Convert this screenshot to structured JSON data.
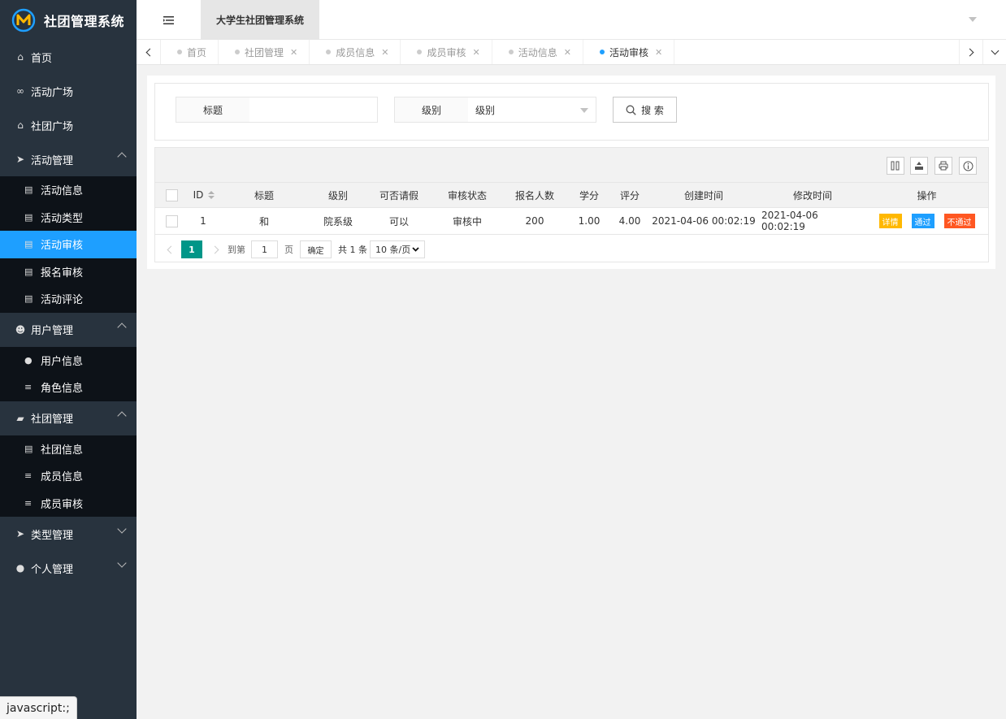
{
  "app": {
    "logo_text": "社团管理系统",
    "system_title": "大学生社团管理系统"
  },
  "sidebar": {
    "items": [
      {
        "label": "首页",
        "icon": "home-icon"
      },
      {
        "label": "活动广场",
        "icon": "bicycle-icon"
      },
      {
        "label": "社团广场",
        "icon": "bank-icon"
      },
      {
        "label": "活动管理",
        "icon": "send-icon",
        "expanded": true,
        "children": [
          {
            "label": "活动信息",
            "icon": "list-icon"
          },
          {
            "label": "活动类型",
            "icon": "list-icon"
          },
          {
            "label": "活动审核",
            "icon": "list-icon",
            "active": true
          },
          {
            "label": "报名审核",
            "icon": "list-icon"
          },
          {
            "label": "活动评论",
            "icon": "list-icon"
          }
        ]
      },
      {
        "label": "用户管理",
        "icon": "users-icon",
        "expanded": true,
        "children": [
          {
            "label": "用户信息",
            "icon": "user-icon"
          },
          {
            "label": "角色信息",
            "icon": "bars-icon"
          }
        ]
      },
      {
        "label": "社团管理",
        "icon": "book-icon",
        "expanded": true,
        "children": [
          {
            "label": "社团信息",
            "icon": "list-icon"
          },
          {
            "label": "成员信息",
            "icon": "bars-icon"
          },
          {
            "label": "成员审核",
            "icon": "bars-icon"
          }
        ]
      },
      {
        "label": "类型管理",
        "icon": "send-icon",
        "expanded": false
      },
      {
        "label": "个人管理",
        "icon": "user-icon",
        "expanded": false
      }
    ]
  },
  "tabs": [
    {
      "label": "首页",
      "closable": false
    },
    {
      "label": "社团管理",
      "closable": true
    },
    {
      "label": "成员信息",
      "closable": true
    },
    {
      "label": "成员审核",
      "closable": true
    },
    {
      "label": "活动信息",
      "closable": true
    },
    {
      "label": "活动审核",
      "closable": true,
      "active": true
    }
  ],
  "search": {
    "title_label": "标题",
    "title_value": "",
    "level_label": "级别",
    "level_selected": "级别",
    "button_label": "搜 索"
  },
  "table": {
    "columns": [
      "ID",
      "标题",
      "级别",
      "可否请假",
      "审核状态",
      "报名人数",
      "学分",
      "评分",
      "创建时间",
      "修改时间",
      "操作"
    ],
    "rows": [
      {
        "id": "1",
        "title": "和",
        "level": "院系级",
        "leave": "可以",
        "status": "审核中",
        "signups": "200",
        "credit": "1.00",
        "score": "4.00",
        "created": "2021-04-06 00:02:19",
        "modified": "2021-04-06 00:02:19"
      }
    ],
    "actions": {
      "detail": "详情",
      "pass": "通过",
      "reject": "不通过"
    }
  },
  "pager": {
    "current": "1",
    "goto_label": "到第",
    "goto_value": "1",
    "page_unit": "页",
    "confirm": "确定",
    "total": "共 1 条",
    "page_size": "10 条/页"
  },
  "status_tip": "javascript:;",
  "colors": {
    "sidebar_bg": "#28333e",
    "submenu_bg": "#0d1218",
    "active_blue": "#1e9fff",
    "pager_green": "#009688",
    "warn": "#ffb800",
    "danger": "#ff5722"
  }
}
